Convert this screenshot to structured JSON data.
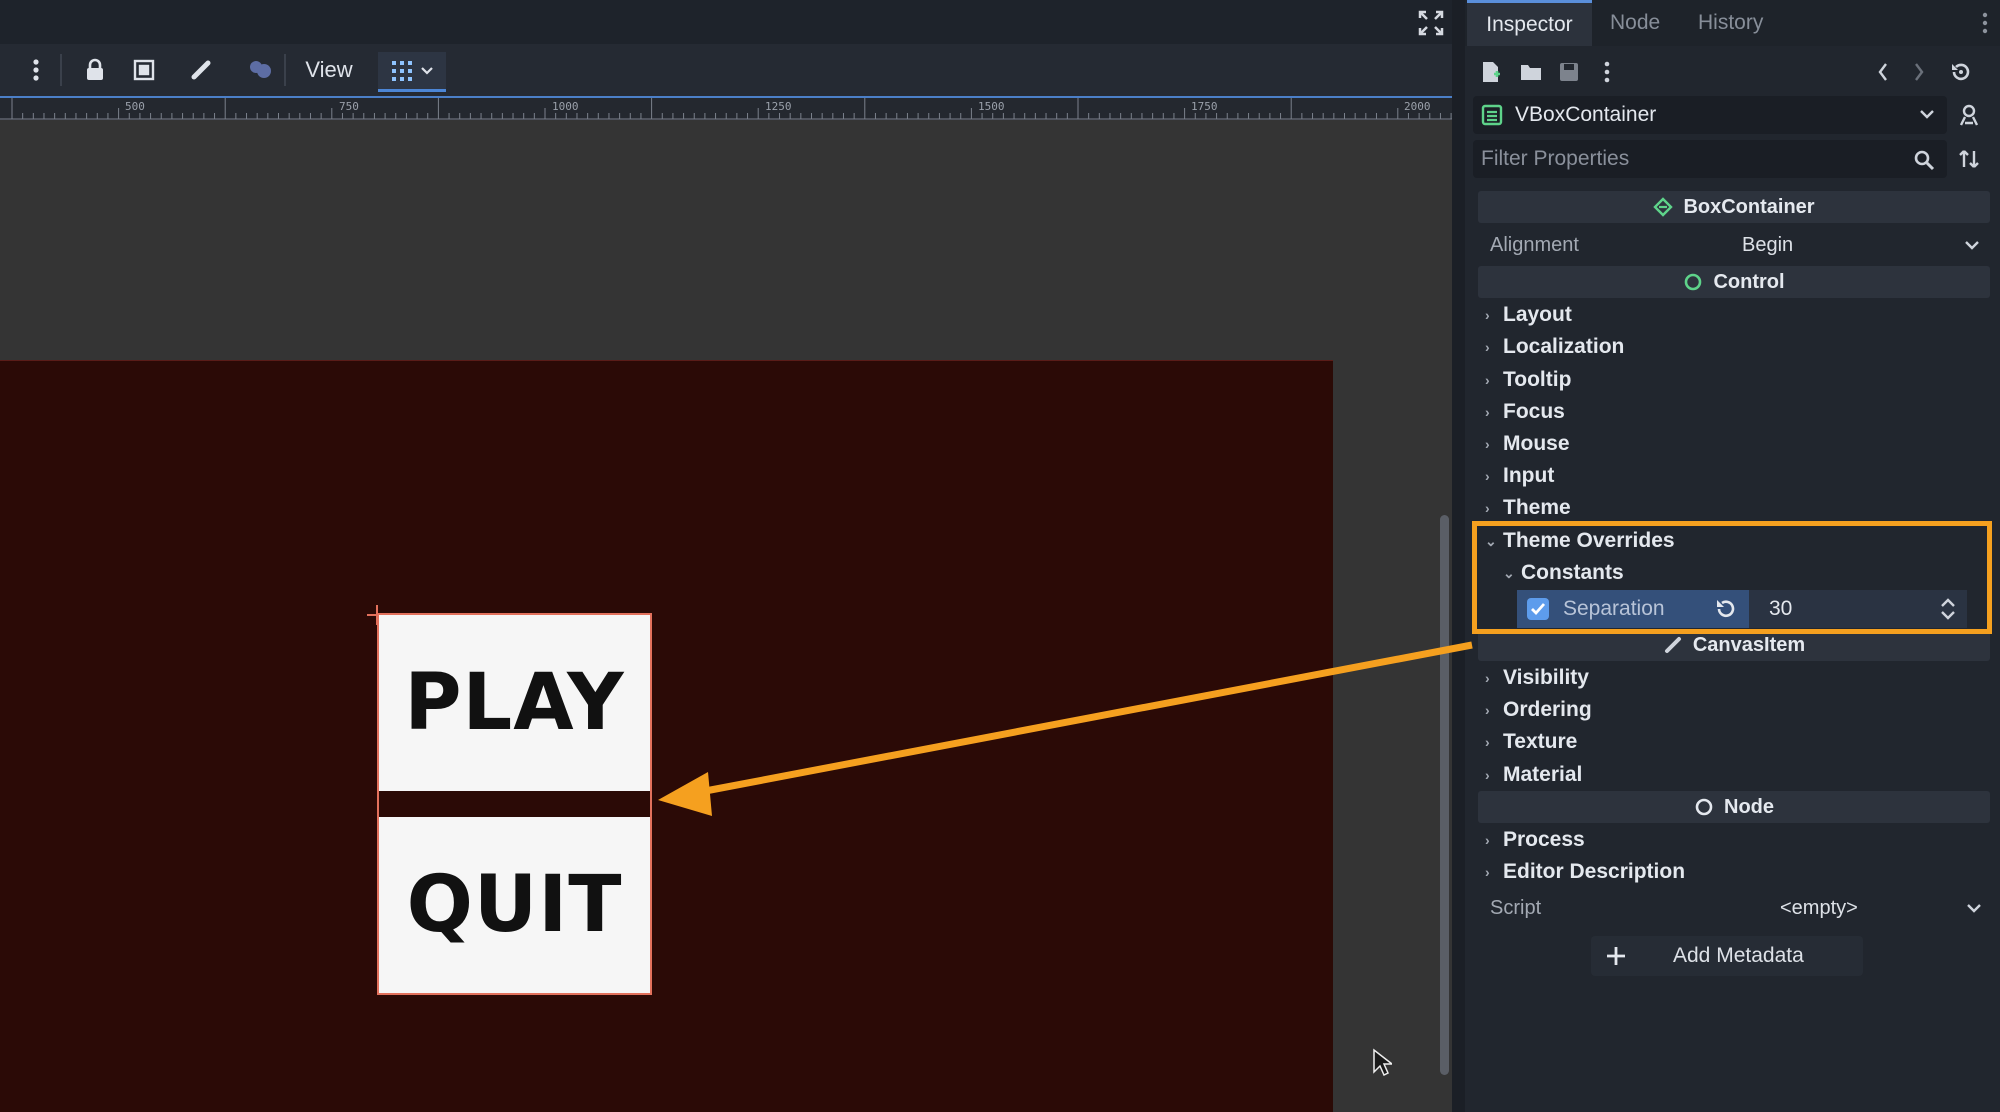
{
  "viewport": {
    "toolbar": {
      "view_label": "View"
    },
    "ruler_labels": [
      "500",
      "750",
      "1000",
      "1250",
      "1500",
      "1750",
      "2000"
    ],
    "buttons": {
      "play": "PLAY",
      "quit": "QUIT"
    }
  },
  "inspector": {
    "tabs": [
      "Inspector",
      "Node",
      "History"
    ],
    "node_type": "VBoxContainer",
    "filter_placeholder": "Filter Properties",
    "sections": {
      "box_container": "BoxContainer",
      "control": "Control",
      "canvas_item": "CanvasItem",
      "node": "Node"
    },
    "alignment": {
      "label": "Alignment",
      "value": "Begin"
    },
    "control_groups": [
      "Layout",
      "Localization",
      "Tooltip",
      "Focus",
      "Mouse",
      "Input",
      "Theme"
    ],
    "theme_overrides": "Theme Overrides",
    "constants": "Constants",
    "separation": {
      "label": "Separation",
      "value": "30",
      "checked": true
    },
    "canvas_groups": [
      "Visibility",
      "Ordering",
      "Texture",
      "Material"
    ],
    "node_groups": [
      "Process",
      "Editor Description"
    ],
    "script": {
      "label": "Script",
      "value": "<empty>"
    },
    "add_metadata": "Add Metadata"
  },
  "colors": {
    "accent": "#5a8fdb",
    "highlight": "#f5a01f",
    "game_background": "#2b0a06",
    "control_icon": "#5ed38a"
  }
}
